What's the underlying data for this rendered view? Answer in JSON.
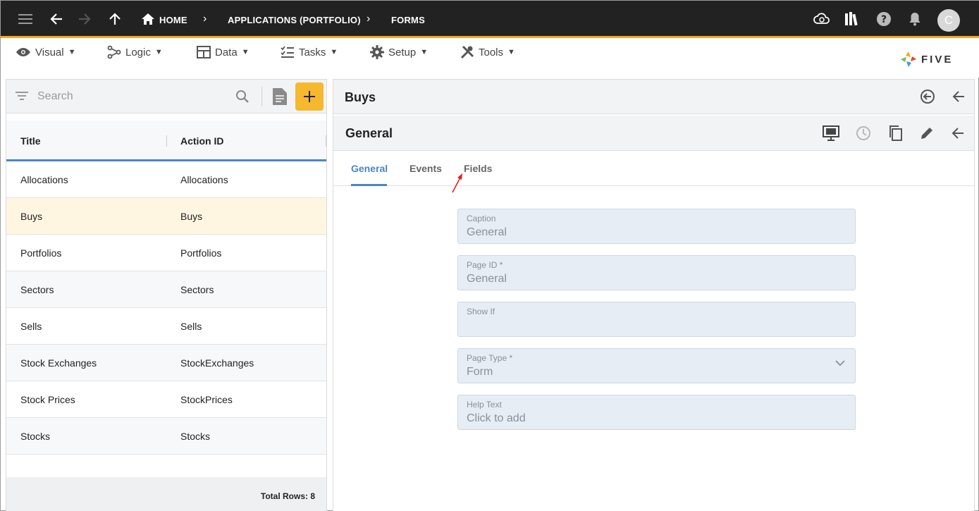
{
  "topbar": {
    "breadcrumb": {
      "home": "HOME",
      "app": "APPLICATIONS (PORTFOLIO)",
      "current": "FORMS"
    },
    "avatar_initial": "C",
    "icons": [
      "menu-icon",
      "back-arrow-icon",
      "forward-arrow-icon",
      "up-arrow-icon",
      "home-icon",
      "cloud-sync-icon",
      "library-icon",
      "help-icon",
      "bell-icon"
    ]
  },
  "menubar": {
    "items": [
      {
        "label": "Visual",
        "icon": "eye-icon"
      },
      {
        "label": "Logic",
        "icon": "logic-icon"
      },
      {
        "label": "Data",
        "icon": "table-icon"
      },
      {
        "label": "Tasks",
        "icon": "checklist-icon"
      },
      {
        "label": "Setup",
        "icon": "gear-icon"
      },
      {
        "label": "Tools",
        "icon": "tools-icon"
      }
    ],
    "logo_text": "FIVE"
  },
  "list": {
    "search_placeholder": "Search",
    "columns": [
      "Title",
      "Action ID"
    ],
    "rows": [
      {
        "title": "Allocations",
        "action_id": "Allocations"
      },
      {
        "title": "Buys",
        "action_id": "Buys"
      },
      {
        "title": "Portfolios",
        "action_id": "Portfolios"
      },
      {
        "title": "Sectors",
        "action_id": "Sectors"
      },
      {
        "title": "Sells",
        "action_id": "Sells"
      },
      {
        "title": "Stock Exchanges",
        "action_id": "StockExchanges"
      },
      {
        "title": "Stock Prices",
        "action_id": "StockPrices"
      },
      {
        "title": "Stocks",
        "action_id": "Stocks"
      }
    ],
    "selected_row": "Buys",
    "total": "Total Rows: 8"
  },
  "detail": {
    "title": "Buys",
    "section_title": "General",
    "tabs": [
      "General",
      "Events",
      "Fields"
    ],
    "active_tab": "General",
    "fields": [
      {
        "label": "Caption",
        "value": "General"
      },
      {
        "label": "Page ID *",
        "value": "General"
      },
      {
        "label": "Show If",
        "value": ""
      },
      {
        "label": "Page Type *",
        "value": "Form"
      },
      {
        "label": "Help Text",
        "value": "Click to add"
      }
    ]
  },
  "colors": {
    "topbar": "#222222",
    "accent_orange": "#f5a623",
    "add_button": "#f5b82e",
    "tab_active": "#4a86c8",
    "selected_row": "#fff6e2",
    "field_bg": "#e6edf5",
    "annotation_arrow": "#e02020"
  }
}
